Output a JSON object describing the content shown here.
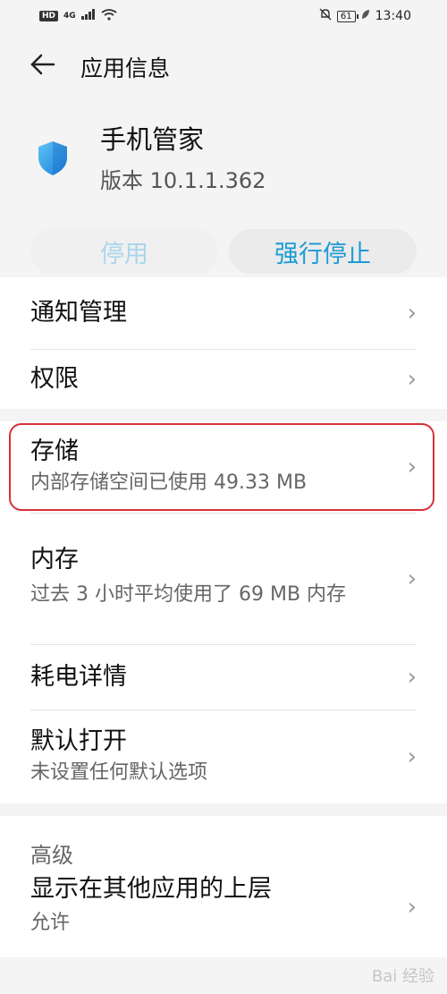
{
  "status_bar": {
    "left_badge": "HD",
    "signal": "4G",
    "battery": "61",
    "time": "13:40"
  },
  "header": {
    "back_icon": "arrow-left-icon",
    "title": "应用信息"
  },
  "app": {
    "icon": "shield-icon",
    "name": "手机管家",
    "version": "版本 10.1.1.362"
  },
  "buttons": {
    "disable": "停用",
    "force_stop": "强行停止"
  },
  "menu": [
    {
      "title": "通知管理"
    },
    {
      "title": "权限"
    },
    {
      "title": "存储",
      "subtitle": "内部存储空间已使用 49.33 MB",
      "highlighted": true
    },
    {
      "title": "内存",
      "subtitle": "过去 3 小时平均使用了 69 MB 内存"
    },
    {
      "title": "耗电详情"
    },
    {
      "title": "默认打开",
      "subtitle": "未设置任何默认选项"
    }
  ],
  "advanced": {
    "label": "高级",
    "items": [
      {
        "title": "显示在其他应用的上层",
        "subtitle": "允许"
      }
    ]
  },
  "watermark": "Bai 经验",
  "colors": {
    "accent": "#1c9ad6",
    "disabled_text": "#a9d6ec",
    "highlight_border": "#d8303a"
  }
}
